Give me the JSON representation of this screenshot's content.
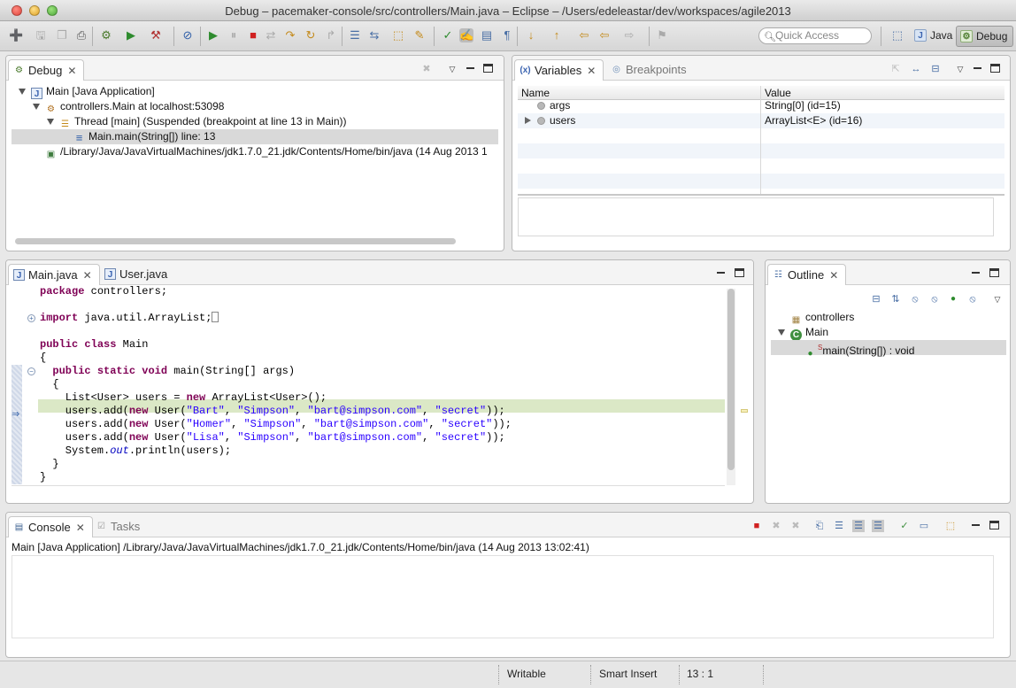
{
  "window": {
    "title": "Debug – pacemaker-console/src/controllers/Main.java – Eclipse – /Users/edeleastar/dev/workspaces/agile2013"
  },
  "toolbar": {
    "quick_access_placeholder": "Quick Access",
    "perspectives": [
      {
        "label": "Java",
        "icon": "java-perspective-icon"
      },
      {
        "label": "Debug",
        "icon": "debug-perspective-icon",
        "active": true
      }
    ]
  },
  "debug_view": {
    "tab_label": "Debug",
    "tree": [
      {
        "label": "Main [Java Application]",
        "icon": "java-app-icon"
      },
      {
        "label": "controllers.Main at localhost:53098",
        "icon": "debug-target-icon"
      },
      {
        "label": "Thread [main] (Suspended (breakpoint at line 13 in Main))",
        "icon": "thread-suspended-icon"
      },
      {
        "label": "Main.main(String[]) line: 13",
        "icon": "stack-frame-icon",
        "selected": true
      },
      {
        "label": "/Library/Java/JavaVirtualMachines/jdk1.7.0_21.jdk/Contents/Home/bin/java (14 Aug 2013 1",
        "icon": "process-icon"
      }
    ]
  },
  "variables_view": {
    "tabs": [
      {
        "label": "Variables",
        "icon": "variables-icon",
        "active": true
      },
      {
        "label": "Breakpoints",
        "icon": "breakpoints-icon",
        "active": false
      }
    ],
    "columns": [
      "Name",
      "Value"
    ],
    "rows": [
      {
        "name": "args",
        "value": "String[0]  (id=15)",
        "expandable": false
      },
      {
        "name": "users",
        "value": "ArrayList<E>  (id=16)",
        "expandable": true
      }
    ]
  },
  "editor": {
    "tabs": [
      {
        "label": "Main.java",
        "active": true
      },
      {
        "label": "User.java",
        "active": false
      }
    ],
    "current_line": 13
  },
  "outline_view": {
    "tab_label": "Outline",
    "items": [
      {
        "label": "controllers",
        "icon": "package-icon"
      },
      {
        "label": "Main",
        "icon": "class-icon"
      },
      {
        "label": "main(String[]) : void",
        "icon": "method-icon",
        "modifier": "S"
      }
    ]
  },
  "console_view": {
    "tabs": [
      {
        "label": "Console",
        "active": true
      },
      {
        "label": "Tasks",
        "active": false
      }
    ],
    "process_line": "Main [Java Application] /Library/Java/JavaVirtualMachines/jdk1.7.0_21.jdk/Contents/Home/bin/java (14 Aug 2013 13:02:41)"
  },
  "status_bar": {
    "writable": "Writable",
    "insert_mode": "Smart Insert",
    "position": "13 : 1"
  },
  "colors": {
    "keyword": "#7f0055",
    "string": "#2a00ff",
    "current_line": "#dbe8c6",
    "selection": "#d9d9d9"
  }
}
